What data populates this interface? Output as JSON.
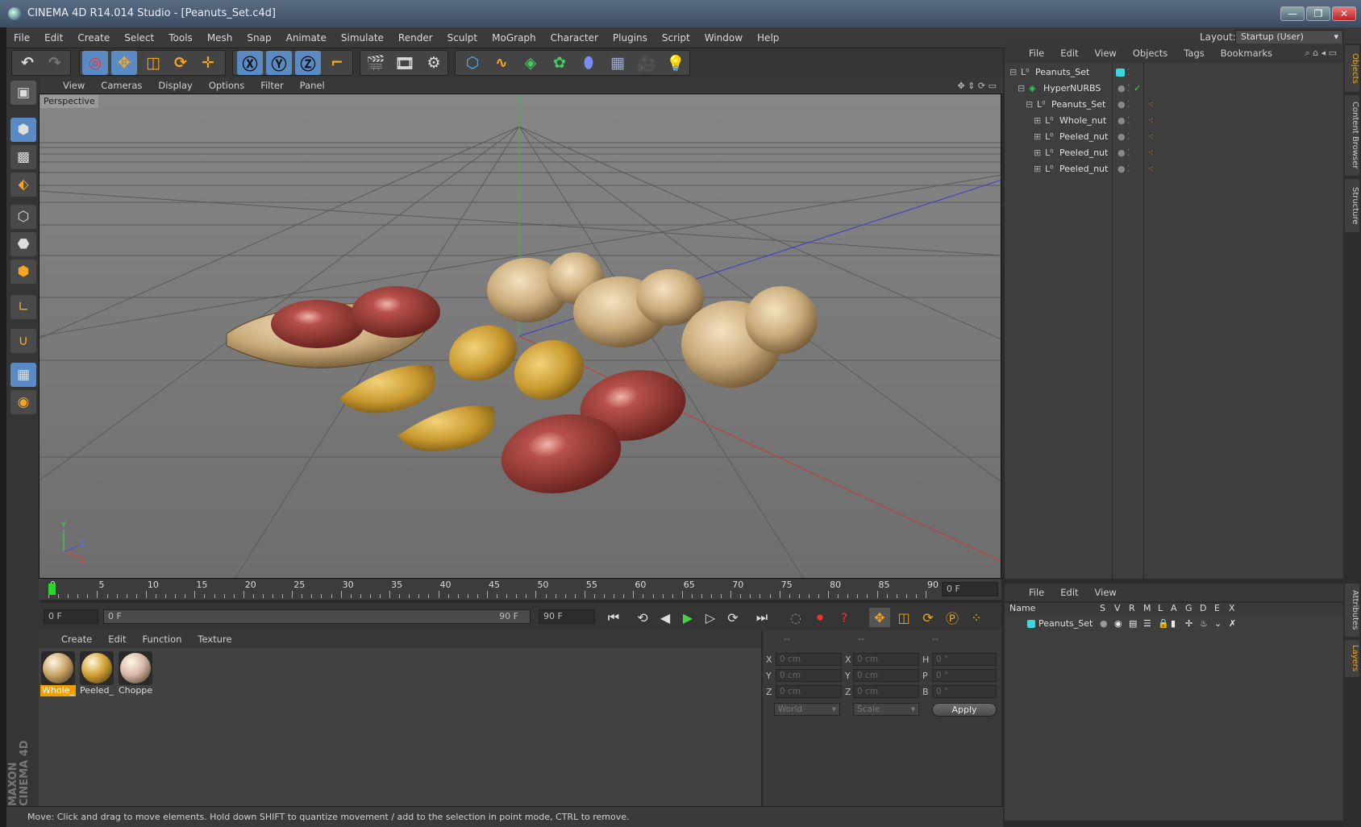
{
  "window": {
    "title": "CINEMA 4D R14.014 Studio - [Peanuts_Set.c4d]",
    "minimize": "—",
    "maximize": "❐",
    "close": "✕"
  },
  "menubar": {
    "items": [
      "File",
      "Edit",
      "Create",
      "Select",
      "Tools",
      "Mesh",
      "Snap",
      "Animate",
      "Simulate",
      "Render",
      "Sculpt",
      "MoGraph",
      "Character",
      "Plugins",
      "Script",
      "Window",
      "Help"
    ],
    "layout_label": "Layout:",
    "layout_value": "Startup (User)"
  },
  "viewport": {
    "menu": [
      "View",
      "Cameras",
      "Display",
      "Options",
      "Filter",
      "Panel"
    ],
    "label": "Perspective",
    "axis_y": "Y",
    "axis_x": "X",
    "axis_z": "Z"
  },
  "timeline": {
    "ticks": [
      "0",
      "5",
      "10",
      "15",
      "20",
      "25",
      "30",
      "35",
      "40",
      "45",
      "50",
      "55",
      "60",
      "65",
      "70",
      "75",
      "80",
      "85",
      "90"
    ],
    "current_frame": "0 F",
    "start_field": "0 F",
    "range_start": "0 F",
    "range_end": "90 F",
    "end_field": "90 F"
  },
  "material_manager": {
    "menu": [
      "Create",
      "Edit",
      "Function",
      "Texture"
    ],
    "materials": [
      {
        "label": "Whole_",
        "color": "#c9a56a"
      },
      {
        "label": "Peeled_",
        "color": "#d2a234"
      },
      {
        "label": "Choppe",
        "color": "#d8b8a8"
      }
    ]
  },
  "coordinates": {
    "col_headers": [
      "--",
      "--",
      "--"
    ],
    "rows": [
      {
        "l1": "X",
        "v1": "0 cm",
        "l2": "X",
        "v2": "0 cm",
        "l3": "H",
        "v3": "0 °"
      },
      {
        "l1": "Y",
        "v1": "0 cm",
        "l2": "Y",
        "v2": "0 cm",
        "l3": "P",
        "v3": "0 °"
      },
      {
        "l1": "Z",
        "v1": "0 cm",
        "l2": "Z",
        "v2": "0 cm",
        "l3": "B",
        "v3": "0 °"
      }
    ],
    "mode1": "World",
    "mode2": "Scale",
    "apply": "Apply"
  },
  "status": "Move: Click and drag to move elements. Hold down SHIFT to quantize movement / add to the selection in point mode, CTRL to remove.",
  "object_manager": {
    "menu": [
      "File",
      "Edit",
      "View",
      "Objects",
      "Tags",
      "Bookmarks"
    ],
    "objects": [
      {
        "name": "Peanuts_Set"
      },
      {
        "name": "HyperNURBS"
      },
      {
        "name": "Peanuts_Set"
      },
      {
        "name": "Whole_nut"
      },
      {
        "name": "Peeled_nut"
      },
      {
        "name": "Peeled_nut"
      },
      {
        "name": "Peeled_nut"
      }
    ]
  },
  "layer_manager": {
    "menu": [
      "File",
      "Edit",
      "View"
    ],
    "columns": [
      "Name",
      "S",
      "V",
      "R",
      "M",
      "L",
      "A",
      "G",
      "D",
      "E",
      "X"
    ],
    "layer_name": "Peanuts_Set"
  },
  "right_tabs": [
    "Objects",
    "Content Browser",
    "Structure",
    "Attributes",
    "Layers"
  ],
  "colors": {
    "accent": "#4aa3ff",
    "active_tool": "#5a8bc4",
    "selected_material": "#f0a000",
    "layer_color": "#3ed6e0"
  }
}
